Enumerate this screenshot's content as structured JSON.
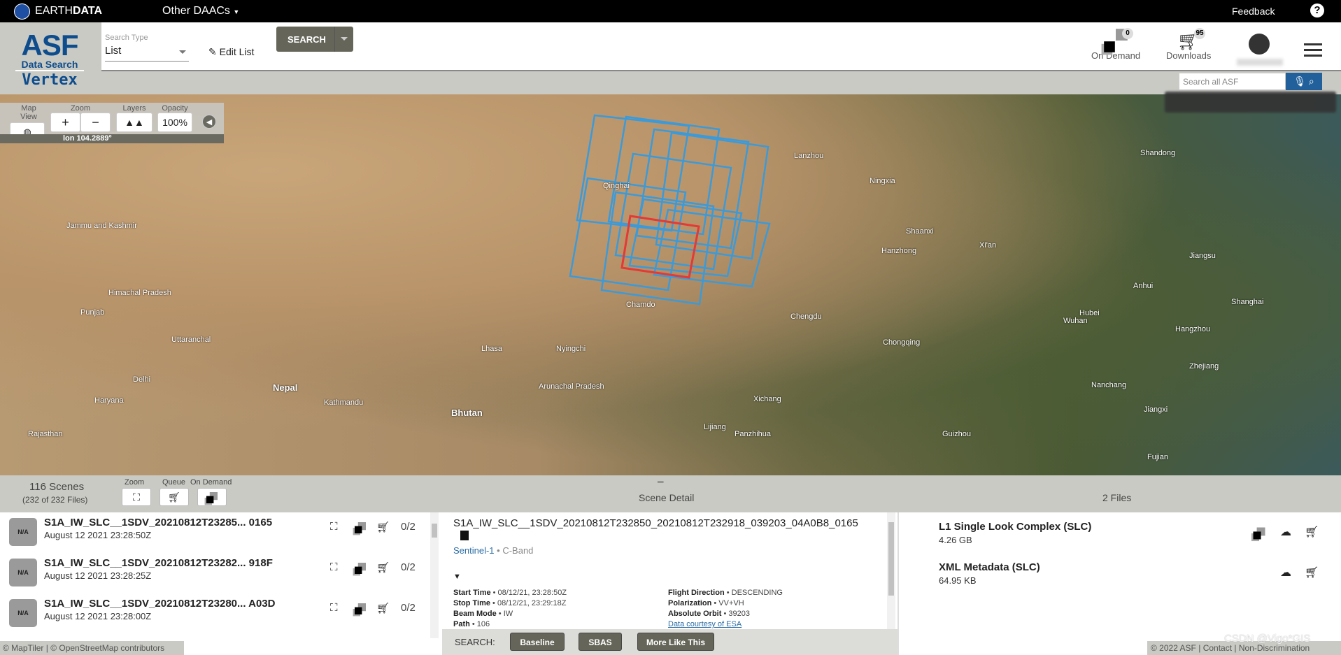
{
  "topbar": {
    "brand_light": "EARTH",
    "brand_bold": "DATA",
    "daacs": "Other DAACs",
    "feedback": "Feedback",
    "help": "?"
  },
  "header": {
    "logo_asf": "ASF",
    "logo_sub": "Data Search",
    "logo_vertex": "Vertex",
    "search_type_label": "Search Type",
    "search_type_value": "List",
    "edit_list": "Edit List",
    "search_button": "SEARCH",
    "on_demand": "On Demand",
    "on_demand_count": "0",
    "downloads": "Downloads",
    "downloads_count": "95",
    "search_all_placeholder": "Search all ASF"
  },
  "map_controls": {
    "map_view": "Map View",
    "zoom": "Zoom",
    "zoom_in": "+",
    "zoom_out": "−",
    "layers": "Layers",
    "opacity": "Opacity",
    "opacity_value": "100%",
    "lon": "lon 104.2889°"
  },
  "map": {
    "labels": [
      "Qinghai",
      "Chamdo",
      "Lhasa",
      "Nyingchi",
      "Nepal",
      "Bhutan",
      "Kathmandu",
      "Arunachal Pradesh",
      "Jammu and Kashmir",
      "Himachal Pradesh",
      "Punjab",
      "Uttaranchal",
      "Delhi",
      "Haryana",
      "Rajasthan",
      "Lanzhou",
      "Ningxia",
      "Shaanxi",
      "Chengdu",
      "Chongqing",
      "Hubei",
      "Anhui",
      "Jiangsu",
      "Shanghai",
      "Zhejiang",
      "Jiangxi",
      "Fujian",
      "Guizhou",
      "Shandong",
      "Hanzhong",
      "Xi'an",
      "Wuhan",
      "Nanchang",
      "Hangzhou",
      "Xichang",
      "Lijiang",
      "Panzhihua"
    ]
  },
  "results": {
    "scenes": "116 Scenes",
    "files_count": "(232 of 232 Files)",
    "zoom": "Zoom",
    "queue": "Queue",
    "on_demand": "On Demand",
    "scene_detail": "Scene Detail",
    "files_header": "2 Files",
    "items": [
      {
        "thumb": "N/A",
        "name": "S1A_IW_SLC__1SDV_20210812T23285... 0165",
        "date": "August 12 2021 23:28:50Z",
        "count": "0/2"
      },
      {
        "thumb": "N/A",
        "name": "S1A_IW_SLC__1SDV_20210812T23282... 918F",
        "date": "August 12 2021 23:28:25Z",
        "count": "0/2"
      },
      {
        "thumb": "N/A",
        "name": "S1A_IW_SLC__1SDV_20210812T23280... A03D",
        "date": "August 12 2021 23:28:00Z",
        "count": "0/2"
      }
    ]
  },
  "detail": {
    "title": "S1A_IW_SLC__1SDV_20210812T232850_20210812T232918_039203_04A0B8_0165",
    "platform": "Sentinel-1",
    "band": " • C-Band",
    "toggle": "▼",
    "left": [
      {
        "k": "Start Time",
        "v": " • 08/12/21, 23:28:50Z"
      },
      {
        "k": "Stop Time",
        "v": " • 08/12/21, 23:29:18Z"
      },
      {
        "k": "Beam Mode",
        "v": " • IW"
      },
      {
        "k": "Path",
        "v": " • 106"
      }
    ],
    "right": [
      {
        "k": "Flight Direction",
        "v": " • DESCENDING"
      },
      {
        "k": "Polarization",
        "v": " • VV+VH"
      },
      {
        "k": "Absolute Orbit",
        "v": " • 39203"
      }
    ],
    "courtesy": "Data courtesy of ESA",
    "search_label": "SEARCH:",
    "baseline": "Baseline",
    "sbas": "SBAS",
    "more_like": "More Like This"
  },
  "files": [
    {
      "name": "L1 Single Look Complex (SLC)",
      "size": "4.26 GB"
    },
    {
      "name": "XML Metadata (SLC)",
      "size": "64.95 KB"
    }
  ],
  "footer": {
    "map_attribution": "© MapTiler | © OpenStreetMap contributors",
    "copyright": "© 2022 ASF",
    "contact": "Contact",
    "nondisc": "Non-Discrimination",
    "watermark": "CSDN @Vigo*GIS"
  },
  "colors": {
    "accent_blue": "#21609b",
    "footprint": "#3b9ad9",
    "selected_footprint": "#e53935",
    "button_gray": "#656559"
  }
}
